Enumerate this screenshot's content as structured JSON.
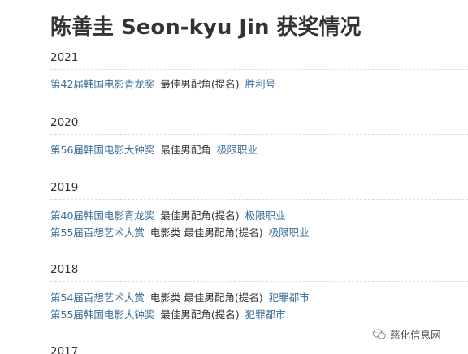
{
  "page": {
    "title": "陈善圭 Seon-kyu Jin 获奖情况"
  },
  "years": [
    {
      "year": "2021",
      "awards": [
        {
          "award": "第42届韩国电影青龙奖",
          "category": "最佳男配角(提名)",
          "film": "胜利号"
        }
      ]
    },
    {
      "year": "2020",
      "awards": [
        {
          "award": "第56届韩国电影大钟奖",
          "category": "最佳男配角",
          "film": "极限职业"
        }
      ]
    },
    {
      "year": "2019",
      "awards": [
        {
          "award": "第40届韩国电影青龙奖",
          "category": "最佳男配角(提名)",
          "film": "极限职业"
        },
        {
          "award": "第55届百想艺术大赏",
          "category": "电影类 最佳男配角(提名)",
          "film": "极限职业"
        }
      ]
    },
    {
      "year": "2018",
      "awards": [
        {
          "award": "第54届百想艺术大赏",
          "category": "电影类 最佳男配角(提名)",
          "film": "犯罪都市"
        },
        {
          "award": "第55届韩国电影大钟奖",
          "category": "最佳男配角(提名)",
          "film": "犯罪都市"
        }
      ]
    },
    {
      "year": "2017",
      "awards": []
    }
  ],
  "watermark": {
    "text": "慈化信息网",
    "icon": "wechat-icon"
  },
  "colors": {
    "link": "#3b6e9a",
    "text": "#333333",
    "divider": "#dddddd"
  }
}
